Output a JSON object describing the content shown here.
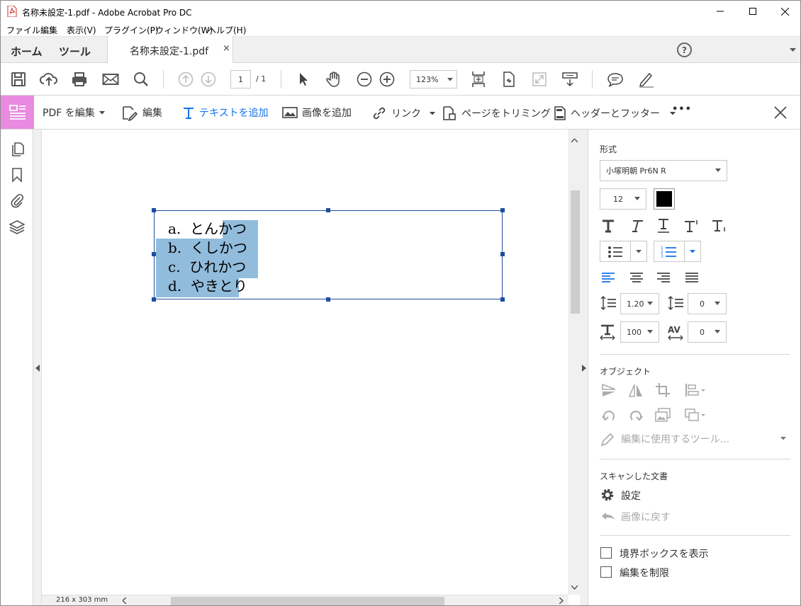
{
  "window": {
    "title": "名称未設定-1.pdf - Adobe Acrobat Pro DC"
  },
  "menu": [
    "ファイル",
    "編集",
    "表示(V)",
    "プラグイン(P)",
    "ウィンドウ(W)",
    "ヘルプ(H)"
  ],
  "tabs": {
    "home": "ホーム",
    "tools": "ツール",
    "document": "名称未設定-1.pdf",
    "close": "×",
    "help": "?"
  },
  "toolbar": {
    "page_current": "1",
    "page_total": "/  1",
    "zoom": "123%"
  },
  "edit_toolbar": {
    "edit_pdf": "PDF を編集",
    "edit": "編集",
    "add_text": "テキストを追加",
    "add_image": "画像を追加",
    "link": "リンク",
    "crop": "ページをトリミング",
    "header_footer": "ヘッダーとフッター",
    "more": "•••"
  },
  "document": {
    "list": [
      {
        "marker": "a.",
        "text": "とんかつ"
      },
      {
        "marker": "b.",
        "text": "くしかつ"
      },
      {
        "marker": "c.",
        "text": "ひれかつ"
      },
      {
        "marker": "d.",
        "text": "やきとり"
      }
    ],
    "page_size": "216 x 303 mm"
  },
  "format_panel": {
    "section_format": "形式",
    "font": "小塚明朝 Pr6N R",
    "font_size": "12",
    "line_spacing": "1.20",
    "para_spacing": "0",
    "h_scale": "100",
    "char_spacing": "0",
    "section_objects": "オブジェクト",
    "edit_tool": "編集に使用するツール...",
    "section_scan": "スキャンした文書",
    "settings": "設定",
    "revert_image": "画像に戻す",
    "show_bbox": "境界ボックスを表示",
    "restrict_edit": "編集を制限"
  },
  "colors": {
    "accent_pink": "#e98be0",
    "selection": "#92bcdc",
    "accent_blue": "#1473e6"
  }
}
